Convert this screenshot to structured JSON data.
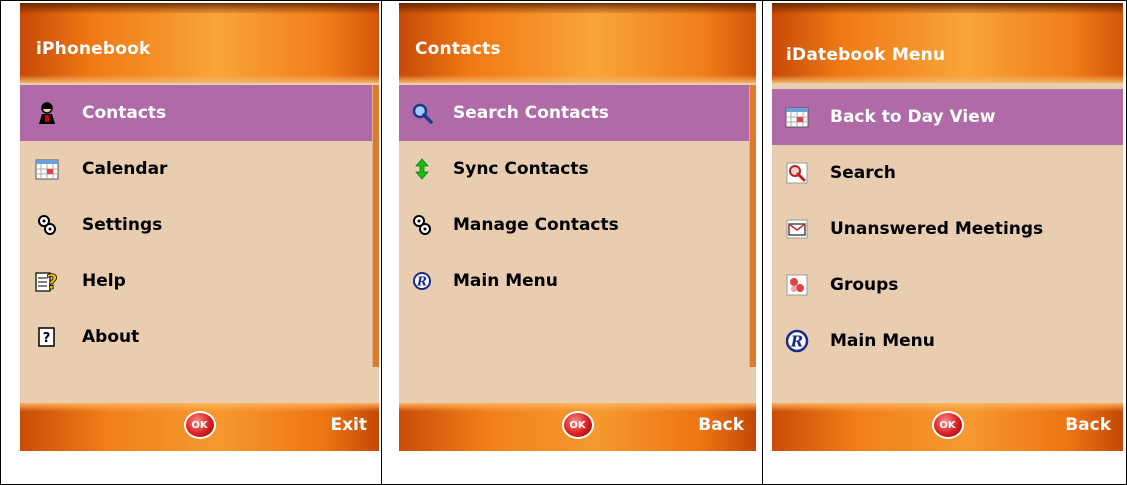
{
  "panels": [
    {
      "title": "iPhonebook",
      "items": [
        {
          "label": "Contacts",
          "icon": "person-icon"
        },
        {
          "label": "Calendar",
          "icon": "calendar-icon"
        },
        {
          "label": "Settings",
          "icon": "settings-icon"
        },
        {
          "label": "Help",
          "icon": "help-icon"
        },
        {
          "label": "About",
          "icon": "about-icon"
        }
      ],
      "ok_label": "OK",
      "right_softkey": "Exit"
    },
    {
      "title": "Contacts",
      "items": [
        {
          "label": "Search Contacts",
          "icon": "search-icon"
        },
        {
          "label": "Sync Contacts",
          "icon": "sync-icon"
        },
        {
          "label": "Manage Contacts",
          "icon": "settings-icon"
        },
        {
          "label": "Main Menu",
          "icon": "registered-icon"
        }
      ],
      "ok_label": "OK",
      "right_softkey": "Back"
    },
    {
      "title": "iDatebook Menu",
      "items": [
        {
          "label": "Back to Day View",
          "icon": "calendar-icon"
        },
        {
          "label": "Search",
          "icon": "search-icon"
        },
        {
          "label": "Unanswered Meetings",
          "icon": "envelope-icon"
        },
        {
          "label": "Groups",
          "icon": "groups-icon"
        },
        {
          "label": "Main Menu",
          "icon": "registered-icon"
        }
      ],
      "ok_label": "OK",
      "right_softkey": "Back"
    }
  ],
  "colors": {
    "selected_row": "#b06aa8",
    "menu_background": "#e9cdb0",
    "bar_orange": "#f07a14"
  }
}
